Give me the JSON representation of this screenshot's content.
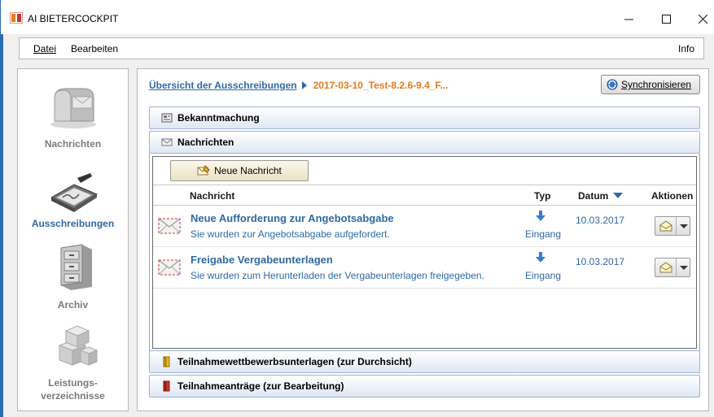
{
  "window": {
    "title": "AI BIETERCOCKPIT",
    "min_symbol": "—",
    "max_symbol": "☐",
    "close_symbol": "✕"
  },
  "menu": {
    "datei": "Datei",
    "bearbeiten": "Bearbeiten",
    "info": "Info"
  },
  "nav": {
    "items": [
      {
        "label": "Nachrichten",
        "icon": "mailbox-icon",
        "active": false
      },
      {
        "label": "Ausschreibungen",
        "icon": "signature-pad-icon",
        "active": true
      },
      {
        "label": "Archiv",
        "icon": "filing-cabinet-icon",
        "active": false
      },
      {
        "label_line1": "Leistungs-",
        "label_line2": "verzeichnisse",
        "icon": "boxes-icon",
        "active": false
      }
    ]
  },
  "breadcrumb": {
    "link": "Übersicht der Ausschreibungen",
    "current": "2017-03-10_Test-8.2.6-9.4_F..."
  },
  "sync_button": {
    "label": "Synchronisieren"
  },
  "sections": {
    "bekanntmachung": "Bekanntmachung",
    "nachrichten": "Nachrichten",
    "teilnahmewettbewerb": "Teilnahmewettbewerbsunterlagen (zur Durchsicht)",
    "teilnahmeantraege": "Teilnahmeanträge (zur Bearbeitung)"
  },
  "inbox": {
    "new_message_button": "Neue Nachricht",
    "columns": {
      "message": "Nachricht",
      "type": "Typ",
      "date": "Datum",
      "actions": "Aktionen"
    },
    "rows": [
      {
        "subject": "Neue Aufforderung zur Angebotsabgabe",
        "preview": "Sie wurden zur Angebotsabgabe aufgefordert.",
        "type": "Eingang",
        "date": "10.03.2017"
      },
      {
        "subject": "Freigabe Vergabeunterlagen",
        "preview": "Sie wurden zum Herunterladen der Vergabeunterlagen freigegeben.",
        "type": "Eingang",
        "date": "10.03.2017"
      }
    ]
  },
  "colors": {
    "accent_blue": "#2f6aa3",
    "breadcrumb_orange": "#e07b1a",
    "section_gradient_bottom": "#dfe7f4"
  }
}
